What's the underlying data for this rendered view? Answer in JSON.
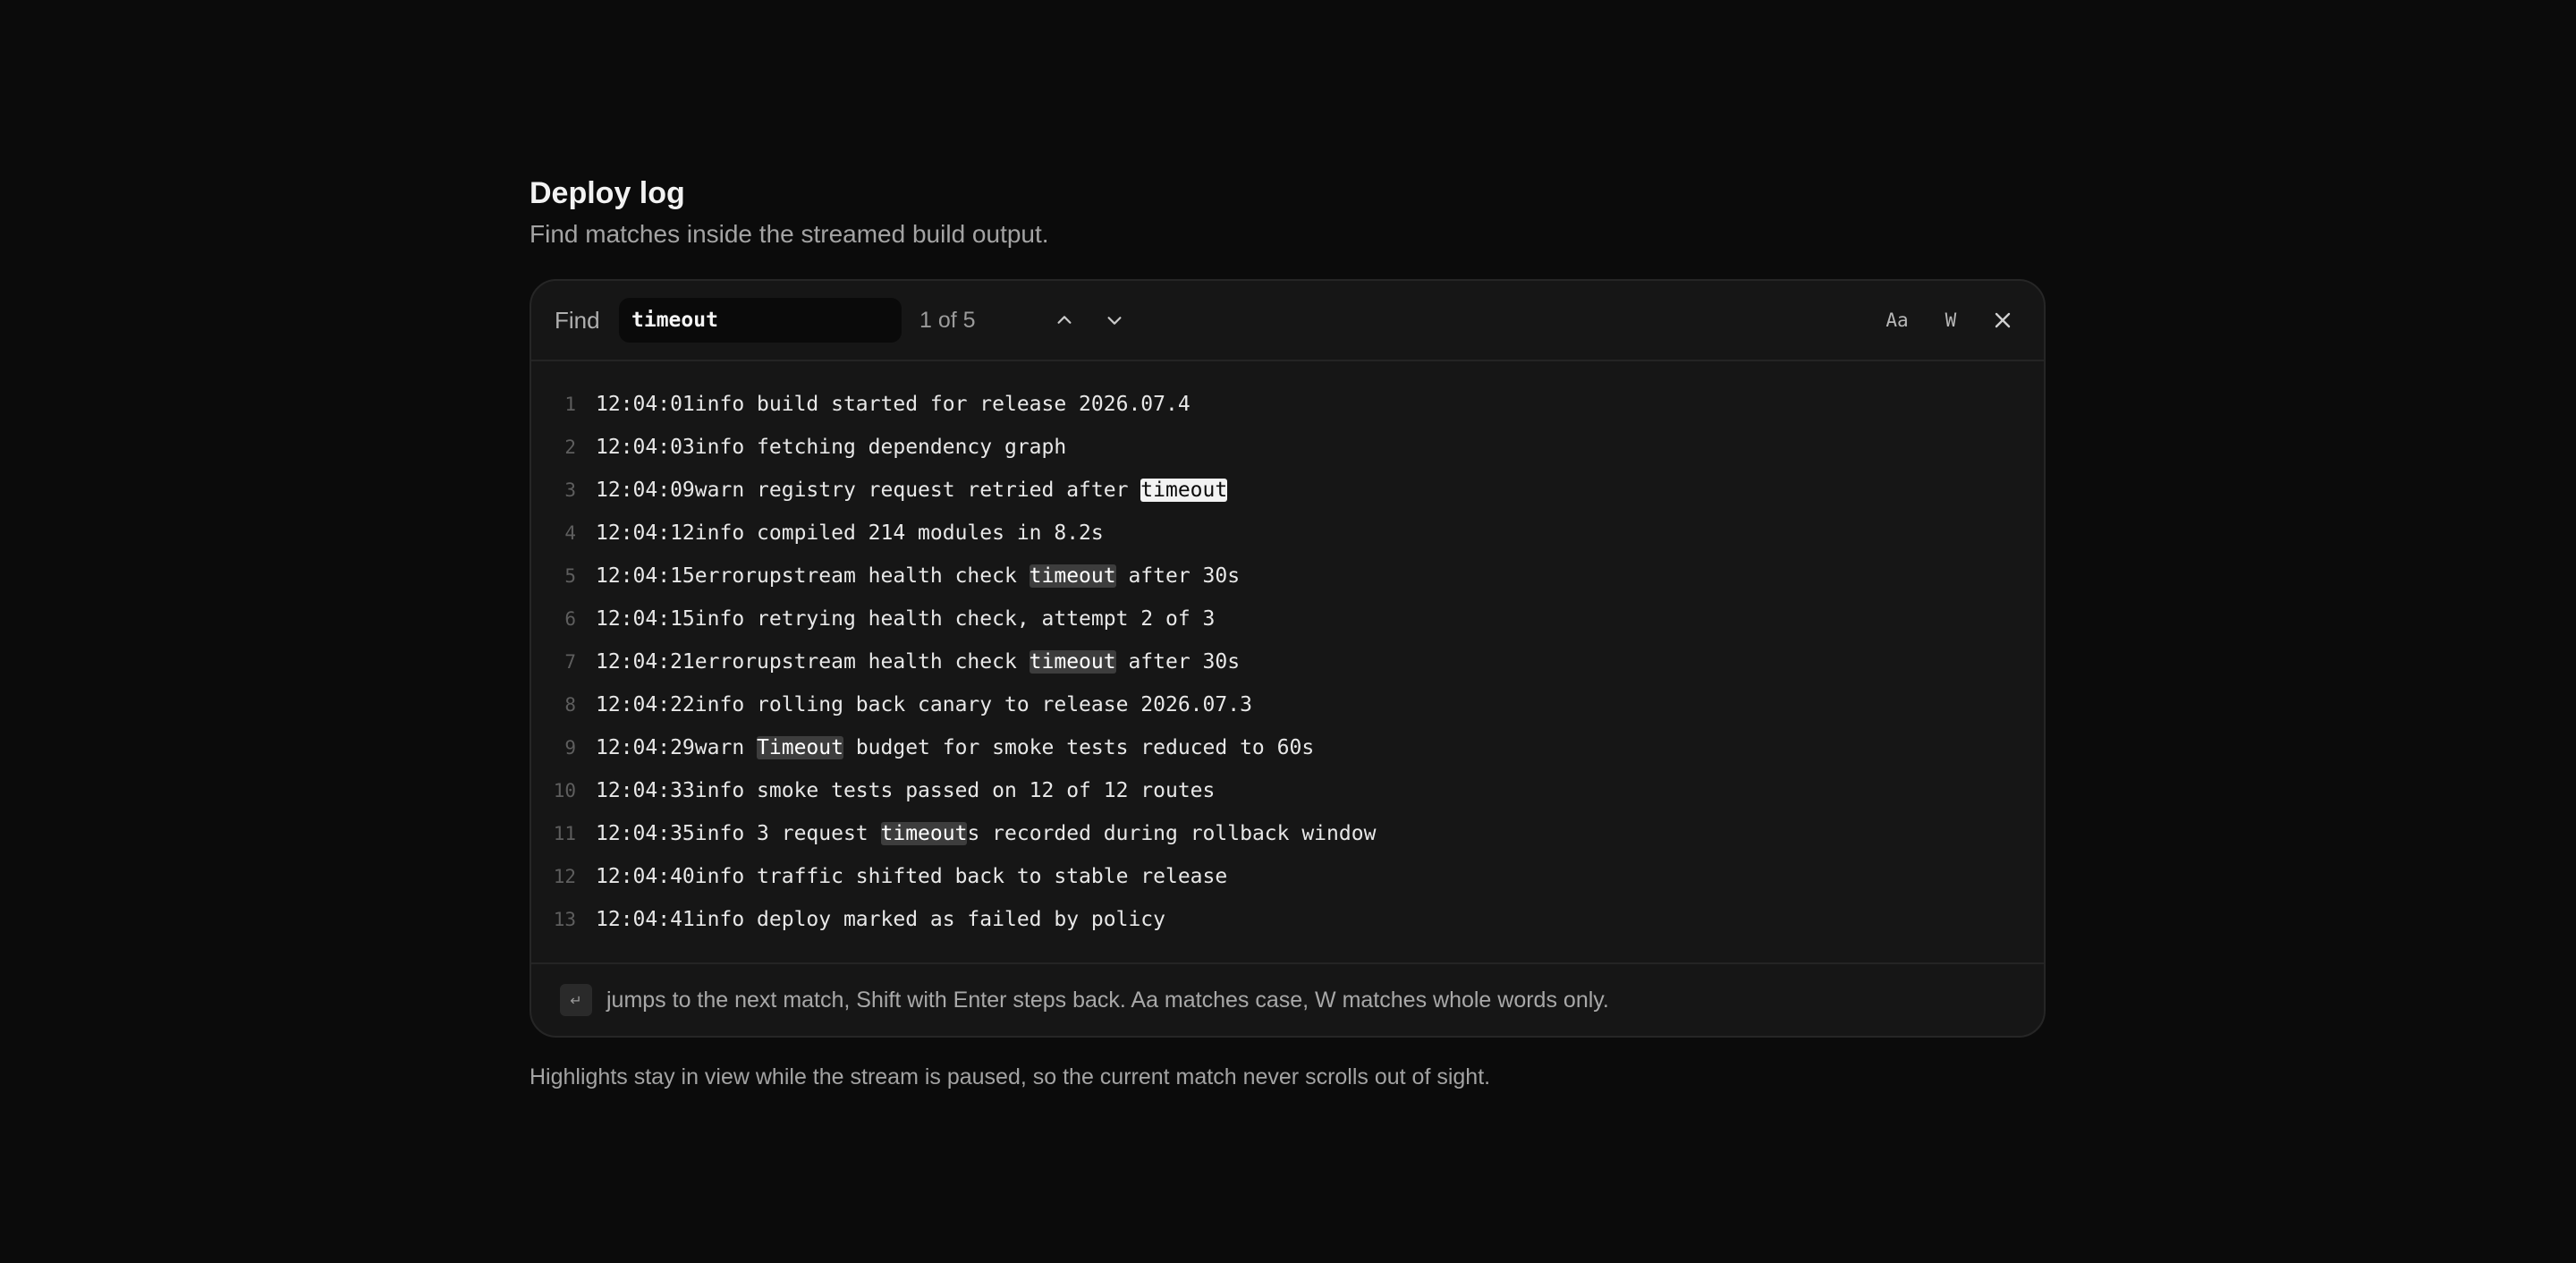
{
  "page": {
    "title": "Deploy log",
    "subtitle": "Find matches inside the streamed build output.",
    "footnote": "Highlights stay in view while the stream is paused, so the current match never scrolls out of sight."
  },
  "findbar": {
    "label": "Find",
    "query": "timeout",
    "match_count": "1 of 5",
    "prev_icon": "chevron-up-icon",
    "next_icon": "chevron-down-icon",
    "match_case_label": "Aa",
    "whole_word_label": "W",
    "close_icon": "close-icon"
  },
  "log": {
    "lines": [
      {
        "n": "1",
        "ts": "12:04:01",
        "lvl": "info ",
        "parts": [
          {
            "t": "build started for release 2026.07.4"
          }
        ]
      },
      {
        "n": "2",
        "ts": "12:04:03",
        "lvl": "info ",
        "parts": [
          {
            "t": "fetching dependency graph"
          }
        ]
      },
      {
        "n": "3",
        "ts": "12:04:09",
        "lvl": "warn ",
        "parts": [
          {
            "t": "registry request retried after "
          },
          {
            "t": "timeout",
            "hl": "current"
          }
        ]
      },
      {
        "n": "4",
        "ts": "12:04:12",
        "lvl": "info ",
        "parts": [
          {
            "t": "compiled 214 modules in 8.2s"
          }
        ]
      },
      {
        "n": "5",
        "ts": "12:04:15",
        "lvl": "error",
        "parts": [
          {
            "t": "upstream health check "
          },
          {
            "t": "timeout",
            "hl": "match"
          },
          {
            "t": " after 30s"
          }
        ]
      },
      {
        "n": "6",
        "ts": "12:04:15",
        "lvl": "info ",
        "parts": [
          {
            "t": "retrying health check, attempt 2 of 3"
          }
        ]
      },
      {
        "n": "7",
        "ts": "12:04:21",
        "lvl": "error",
        "parts": [
          {
            "t": "upstream health check "
          },
          {
            "t": "timeout",
            "hl": "match"
          },
          {
            "t": " after 30s"
          }
        ]
      },
      {
        "n": "8",
        "ts": "12:04:22",
        "lvl": "info ",
        "parts": [
          {
            "t": "rolling back canary to release 2026.07.3"
          }
        ]
      },
      {
        "n": "9",
        "ts": "12:04:29",
        "lvl": "warn ",
        "parts": [
          {
            "t": "Timeout",
            "hl": "match"
          },
          {
            "t": " budget for smoke tests reduced to 60s"
          }
        ]
      },
      {
        "n": "10",
        "ts": "12:04:33",
        "lvl": "info ",
        "parts": [
          {
            "t": "smoke tests passed on 12 of 12 routes"
          }
        ]
      },
      {
        "n": "11",
        "ts": "12:04:35",
        "lvl": "info ",
        "parts": [
          {
            "t": "3 request "
          },
          {
            "t": "timeout",
            "hl": "match"
          },
          {
            "t": "s recorded during rollback window"
          }
        ]
      },
      {
        "n": "12",
        "ts": "12:04:40",
        "lvl": "info ",
        "parts": [
          {
            "t": "traffic shifted back to stable release"
          }
        ]
      },
      {
        "n": "13",
        "ts": "12:04:41",
        "lvl": "info ",
        "parts": [
          {
            "t": "deploy marked as failed by policy"
          }
        ]
      }
    ]
  },
  "hint": {
    "key_glyph": "↵",
    "text": "jumps to the next match, Shift with Enter steps back. Aa matches case, W matches whole words only."
  },
  "colors": {
    "background": "#0b0b0b",
    "panel": "#161616",
    "match_highlight": "#3d3d3d",
    "current_highlight": "#f2f2f2"
  }
}
